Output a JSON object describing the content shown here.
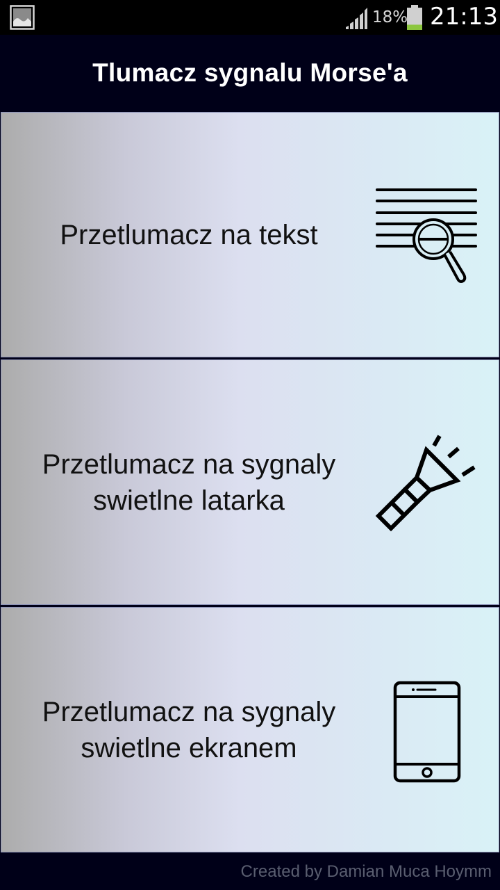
{
  "status_bar": {
    "battery_percent": "18%",
    "battery_level": 0.18,
    "time": "21:13",
    "icons": [
      "gallery-icon",
      "signal-icon",
      "battery-icon"
    ]
  },
  "app_bar": {
    "title": "Tlumacz sygnalu Morse'a"
  },
  "menu": {
    "items": [
      {
        "line1": "Przetlumacz na tekst",
        "line2": "",
        "icon": "text-search-icon"
      },
      {
        "line1": "Przetlumacz na sygnaly",
        "line2": "swietlne latarka",
        "icon": "flashlight-icon"
      },
      {
        "line1": "Przetlumacz na sygnaly",
        "line2": "swietlne ekranem",
        "icon": "smartphone-icon"
      }
    ]
  },
  "footer": {
    "credit": "Created by Damian Muca Hoymm"
  },
  "colors": {
    "app_bar_bg": "#000018",
    "status_bar_bg": "#000000",
    "battery_fill": "#8cc63f",
    "card_gradient_left": "#acacac",
    "card_gradient_right": "#d9f2f7",
    "footer_text": "#5a5e70"
  }
}
